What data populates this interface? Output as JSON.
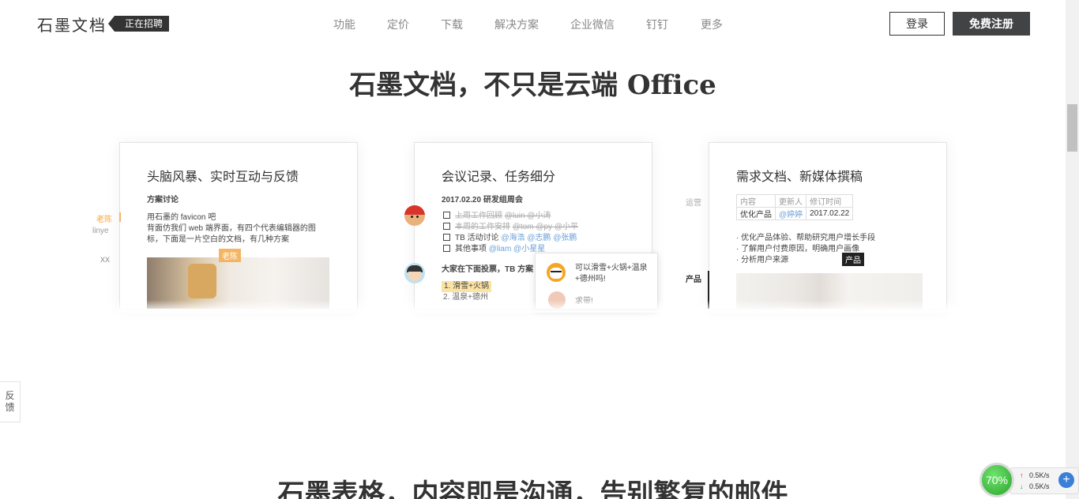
{
  "header": {
    "logo": "石墨文档",
    "hiring_badge": "正在招聘",
    "nav": [
      "功能",
      "定价",
      "下载",
      "解决方案",
      "企业微信",
      "钉钉",
      "更多"
    ],
    "login": "登录",
    "signup": "免费注册"
  },
  "hero": {
    "title": "石墨文档，不只是云端 Office"
  },
  "cards": [
    {
      "title": "头脑风暴、实时互动与反馈",
      "subtitle": "方案讨论",
      "lines": [
        "用石墨的 favicon 吧",
        "背面仿我们 web 端界面，有四个代表编辑器的图",
        "标，下面是一片空白的文档，有几种方案"
      ],
      "side_users": [
        "老陈",
        "linye",
        "xx"
      ],
      "tag": "老陈"
    },
    {
      "title": "会议记录、任务细分",
      "date_heading": "2017.02.20 研发组周会",
      "tasks": [
        {
          "text": "上周工作回顾",
          "mentions": "@luin @小涛",
          "done": true
        },
        {
          "text": "本周的工作安排",
          "mentions": "@tom @py @小平",
          "done": true
        },
        {
          "text": "TB 活动讨论",
          "mentions": "@海浩 @志鹏 @张鹏",
          "done": false
        },
        {
          "text": "其他事项",
          "mentions": "@liam @小星星",
          "done": false
        }
      ],
      "vote_heading": "大家在下面投票，TB 方案",
      "options": [
        "1. 滑雪+火锅",
        "2. 温泉+德州"
      ],
      "popover": [
        "可以滑雪+火锅+温泉+德州吗!",
        "求带!"
      ]
    },
    {
      "title": "需求文档、新媒体撰稿",
      "table_header": [
        "内容",
        "更新人",
        "修订时间"
      ],
      "table_row": [
        "优化产品",
        "@婷婷",
        "2017.02.22"
      ],
      "bullets": [
        "· 优化产品体验、帮助研究用户增长手段",
        "· 了解用户付费原因，明确用户画像",
        "· 分析用户来源"
      ],
      "side_labels": [
        "运营",
        "产品"
      ],
      "tag": "产品"
    }
  ],
  "section2": {
    "title": "石墨表格，内容即是沟通，告别繁复的邮件"
  },
  "feedback": [
    "反",
    "馈"
  ],
  "net_widget": {
    "percent": "70%",
    "up": "0.5K/s",
    "down": "0.5K/s"
  }
}
